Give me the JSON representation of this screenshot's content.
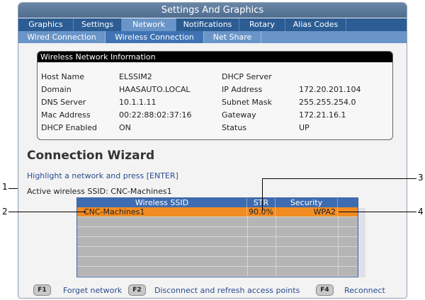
{
  "window": {
    "title": "Settings And Graphics"
  },
  "tabs_primary": [
    {
      "label": "Graphics"
    },
    {
      "label": "Settings"
    },
    {
      "label": "Network"
    },
    {
      "label": "Notifications"
    },
    {
      "label": "Rotary"
    },
    {
      "label": "Alias Codes"
    }
  ],
  "tabs_secondary": [
    {
      "label": "Wired Connection"
    },
    {
      "label": "Wireless Connection"
    },
    {
      "label": "Net Share"
    }
  ],
  "info": {
    "header": "Wireless Network Information",
    "rows": [
      {
        "label1": "Host Name",
        "value1": "ELSSIM2",
        "label2": "DHCP Server",
        "value2": ""
      },
      {
        "label1": "Domain",
        "value1": "HAASAUTO.LOCAL",
        "label2": "IP Address",
        "value2": "172.20.201.104"
      },
      {
        "label1": "DNS Server",
        "value1": "10.1.1.11",
        "label2": "Subnet Mask",
        "value2": "255.255.254.0"
      },
      {
        "label1": "Mac Address",
        "value1": "00:22:88:02:37:16",
        "label2": "Gateway",
        "value2": "172.21.16.1"
      },
      {
        "label1": "DHCP Enabled",
        "value1": "ON",
        "label2": "Status",
        "value2": "UP"
      }
    ]
  },
  "wizard": {
    "title": "Connection Wizard",
    "instruction": "Highlight a network and press [ENTER]",
    "active_ssid": "Active wireless SSID: CNC-Machines1"
  },
  "networks": {
    "columns": [
      "Wireless SSID",
      "STR",
      "Security"
    ],
    "rows": [
      {
        "ssid": "CNC-Machines1",
        "str": "90.0%",
        "security": "WPA2"
      }
    ]
  },
  "function_keys": [
    {
      "key": "F1",
      "label": "Forget network"
    },
    {
      "key": "F2",
      "label": "Disconnect and refresh access points"
    },
    {
      "key": "F4",
      "label": "Reconnect"
    }
  ],
  "callouts": [
    "1",
    "2",
    "3",
    "4"
  ],
  "colors": {
    "selected_row": "#f28c22",
    "tab_bar": "#2b5c93",
    "active_tab": "#6a95c8",
    "grid_header": "#3e6cb0"
  }
}
